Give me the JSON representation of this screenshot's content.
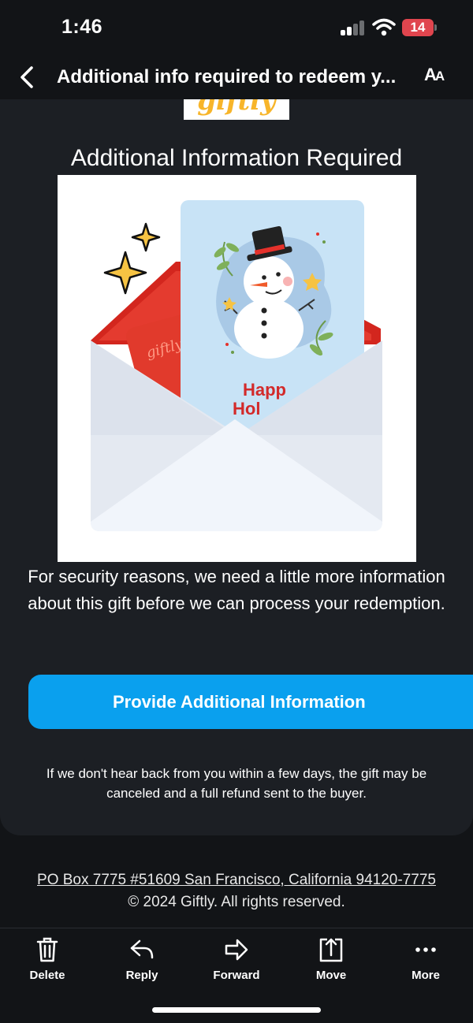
{
  "status_bar": {
    "time": "1:46",
    "battery_level": "14",
    "icons": [
      "signal-icon",
      "wifi-icon",
      "battery-icon"
    ]
  },
  "nav": {
    "title": "Additional info required to redeem y...",
    "back_icon": "chevron-left-icon",
    "text_size_label_big": "A",
    "text_size_label_small": "A"
  },
  "email": {
    "logo_text": "giftly",
    "headline": "Additional Information Required",
    "card_brand": "giftly",
    "card_greeting_line1": "Happ",
    "card_greeting_line2": "Hol",
    "body": "For security reasons, we need a little more information about this gift before we can process your redemption.",
    "cta_label": "Provide Additional Information",
    "warning": "If we don't hear back from you within a few days, the gift may be canceled and a full refund sent to the buyer."
  },
  "footer": {
    "address": "PO Box 7775 #51609 San Francisco, California 94120-7775",
    "copyright": "© 2024 Giftly. All rights reserved."
  },
  "toolbar": {
    "items": [
      {
        "label": "Delete",
        "icon": "trash-icon"
      },
      {
        "label": "Reply",
        "icon": "reply-icon"
      },
      {
        "label": "Forward",
        "icon": "forward-icon"
      },
      {
        "label": "Move",
        "icon": "move-icon"
      },
      {
        "label": "More",
        "icon": "more-icon"
      }
    ]
  },
  "colors": {
    "background": "#121417",
    "card": "#1c1f24",
    "accent": "#0aa0ee",
    "battery": "#e0454e",
    "logo": "#f7b52a"
  }
}
